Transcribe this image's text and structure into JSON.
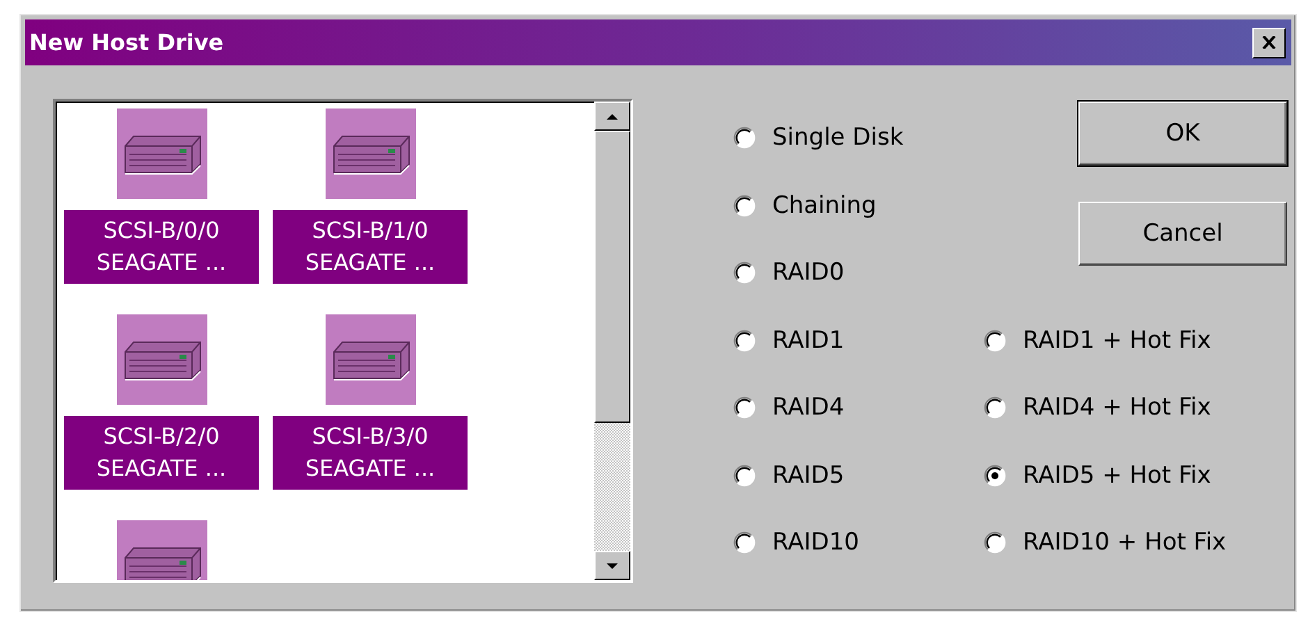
{
  "window": {
    "title": "New Host Drive"
  },
  "drives": [
    {
      "lines": [
        "SCSI-B/0/0",
        "SEAGATE ..."
      ],
      "selected": true
    },
    {
      "lines": [
        "SCSI-B/1/0",
        "SEAGATE ..."
      ],
      "selected": true
    },
    {
      "lines": [
        "SCSI-B/2/0",
        "SEAGATE ..."
      ],
      "selected": true
    },
    {
      "lines": [
        "SCSI-B/3/0",
        "SEAGATE ..."
      ],
      "selected": true
    },
    {
      "selected": true
    }
  ],
  "option_rows": [
    {
      "left": {
        "label": "Single Disk",
        "selected": false
      }
    },
    {
      "left": {
        "label": "Chaining",
        "selected": false
      }
    },
    {
      "left": {
        "label": "RAID0",
        "selected": false
      }
    },
    {
      "left": {
        "label": "RAID1",
        "selected": false
      },
      "right": {
        "label": "RAID1 + Hot Fix",
        "selected": false
      }
    },
    {
      "left": {
        "label": "RAID4",
        "selected": false
      },
      "right": {
        "label": "RAID4 + Hot Fix",
        "selected": false
      }
    },
    {
      "left": {
        "label": "RAID5",
        "selected": false
      },
      "right": {
        "label": "RAID5 + Hot Fix",
        "selected": true
      }
    },
    {
      "left": {
        "label": "RAID10",
        "selected": false
      },
      "right": {
        "label": "RAID10 + Hot Fix",
        "selected": false
      }
    }
  ],
  "buttons": [
    {
      "label": "OK",
      "default": true
    },
    {
      "label": "Cancel",
      "default": false
    }
  ]
}
